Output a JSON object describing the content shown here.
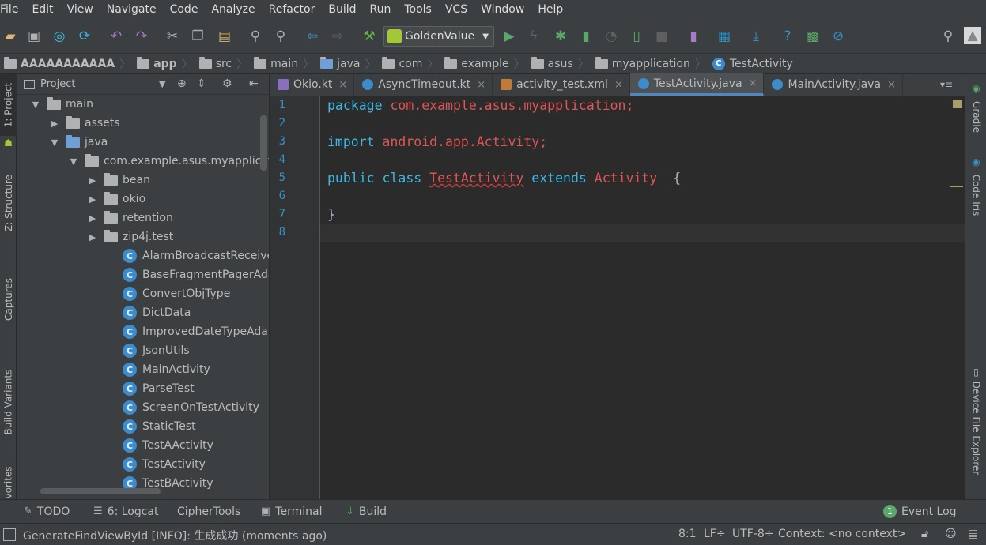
{
  "menu": [
    "File",
    "Edit",
    "View",
    "Navigate",
    "Code",
    "Analyze",
    "Refactor",
    "Build",
    "Run",
    "Tools",
    "VCS",
    "Window",
    "Help"
  ],
  "toolbar": {
    "run_config": "GoldenValue"
  },
  "breadcrumbs": [
    "AAAAAAAAAAA",
    "app",
    "src",
    "main",
    "java",
    "com",
    "example",
    "asus",
    "myapplication",
    "TestActivity"
  ],
  "left_tool_tabs": [
    "1: Project",
    "Z: Structure",
    "Captures",
    "Build Variants",
    "vorites"
  ],
  "project_panel": {
    "title": "Project",
    "tree": [
      {
        "label": "main",
        "arrow": "▼",
        "type": "folder"
      },
      {
        "label": "assets",
        "arrow": "▶",
        "type": "folder"
      },
      {
        "label": "java",
        "arrow": "▼",
        "type": "folder-blue"
      },
      {
        "label": "com.example.asus.myapplicati",
        "arrow": "▼",
        "type": "folder"
      },
      {
        "label": "bean",
        "arrow": "▶",
        "type": "folder"
      },
      {
        "label": "okio",
        "arrow": "▶",
        "type": "folder"
      },
      {
        "label": "retention",
        "arrow": "▶",
        "type": "folder"
      },
      {
        "label": "zip4j.test",
        "arrow": "▶",
        "type": "folder"
      },
      {
        "label": "AlarmBroadcastReceiver",
        "arrow": "",
        "type": "class"
      },
      {
        "label": "BaseFragmentPagerAdapte",
        "arrow": "",
        "type": "class"
      },
      {
        "label": "ConvertObjType",
        "arrow": "",
        "type": "class"
      },
      {
        "label": "DictData",
        "arrow": "",
        "type": "class"
      },
      {
        "label": "ImprovedDateTypeAdapte",
        "arrow": "",
        "type": "class"
      },
      {
        "label": "JsonUtils",
        "arrow": "",
        "type": "class"
      },
      {
        "label": "MainActivity",
        "arrow": "",
        "type": "class"
      },
      {
        "label": "ParseTest",
        "arrow": "",
        "type": "class"
      },
      {
        "label": "ScreenOnTestActivity",
        "arrow": "",
        "type": "class"
      },
      {
        "label": "StaticTest",
        "arrow": "",
        "type": "class"
      },
      {
        "label": "TestAActivity",
        "arrow": "",
        "type": "class"
      },
      {
        "label": "TestActivity",
        "arrow": "",
        "type": "class"
      },
      {
        "label": "TestBActivity",
        "arrow": "",
        "type": "class"
      }
    ]
  },
  "editor_tabs": [
    {
      "label": "Okio.kt",
      "active": false
    },
    {
      "label": "AsyncTimeout.kt",
      "active": false
    },
    {
      "label": "activity_test.xml",
      "active": false
    },
    {
      "label": "TestActivity.java",
      "active": true
    },
    {
      "label": "MainActivity.java",
      "active": false
    }
  ],
  "code": {
    "line_numbers": [
      "1",
      "2",
      "3",
      "4",
      "5",
      "6",
      "7",
      "8"
    ],
    "line1_kw": "package",
    "line1_rest": " com.example.asus.myapplication;",
    "line3_kw": "import",
    "line3_rest": " android.app.Activity;",
    "line5_kw1": "public class ",
    "line5_name": "TestActivity",
    "line5_kw2": " extends ",
    "line5_parent": "Activity",
    "line5_brace": "  {",
    "line7": "}"
  },
  "right_tool_tabs": [
    "Gradle",
    "Code Iris",
    "Device File Explorer"
  ],
  "bottom_tools": {
    "todo": "TODO",
    "logcat": "6: Logcat",
    "ciphertools": "CipherTools",
    "terminal": "Terminal",
    "build": "Build",
    "event_log": "Event Log",
    "event_count": "1"
  },
  "status": {
    "message": "GenerateFindViewById [INFO]: 生成成功 (moments ago)",
    "position": "8:1",
    "line_sep": "LF÷",
    "encoding": "UTF-8÷",
    "context": "Context: <no context>"
  }
}
